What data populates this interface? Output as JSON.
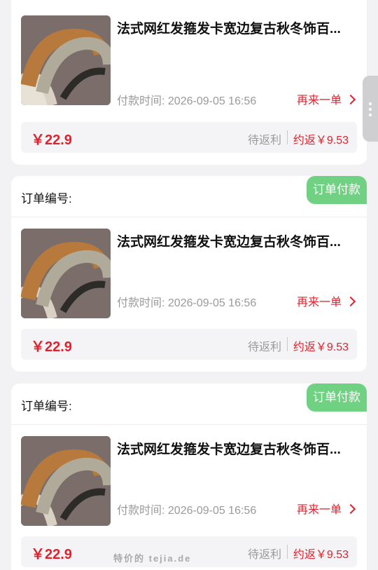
{
  "orders": [
    {
      "order_label": "",
      "badge": "",
      "title": "法式网红发箍发卡宽边复古秋冬饰百...",
      "pay_time": "付款时间: 2026-09-05 16:56",
      "reorder": "再来一单",
      "price": "￥22.9",
      "rebate_status": "待返利",
      "rebate_amount": "约返￥9.53"
    },
    {
      "order_label": "订单编号:",
      "badge": "订单付款",
      "title": "法式网红发箍发卡宽边复古秋冬饰百...",
      "pay_time": "付款时间: 2026-09-05 16:56",
      "reorder": "再来一单",
      "price": "￥22.9",
      "rebate_status": "待返利",
      "rebate_amount": "约返￥9.53"
    },
    {
      "order_label": "订单编号:",
      "badge": "订单付款",
      "title": "法式网红发箍发卡宽边复古秋冬饰百...",
      "pay_time": "付款时间: 2026-09-05 16:56",
      "reorder": "再来一单",
      "price": "￥22.9",
      "rebate_status": "待返利",
      "rebate_amount": "约返￥9.53"
    }
  ],
  "watermark": "特价的 tejia.de",
  "colors": {
    "accent_red": "#e0222e",
    "badge_green": "#70d183",
    "background": "#f2f2f4"
  }
}
